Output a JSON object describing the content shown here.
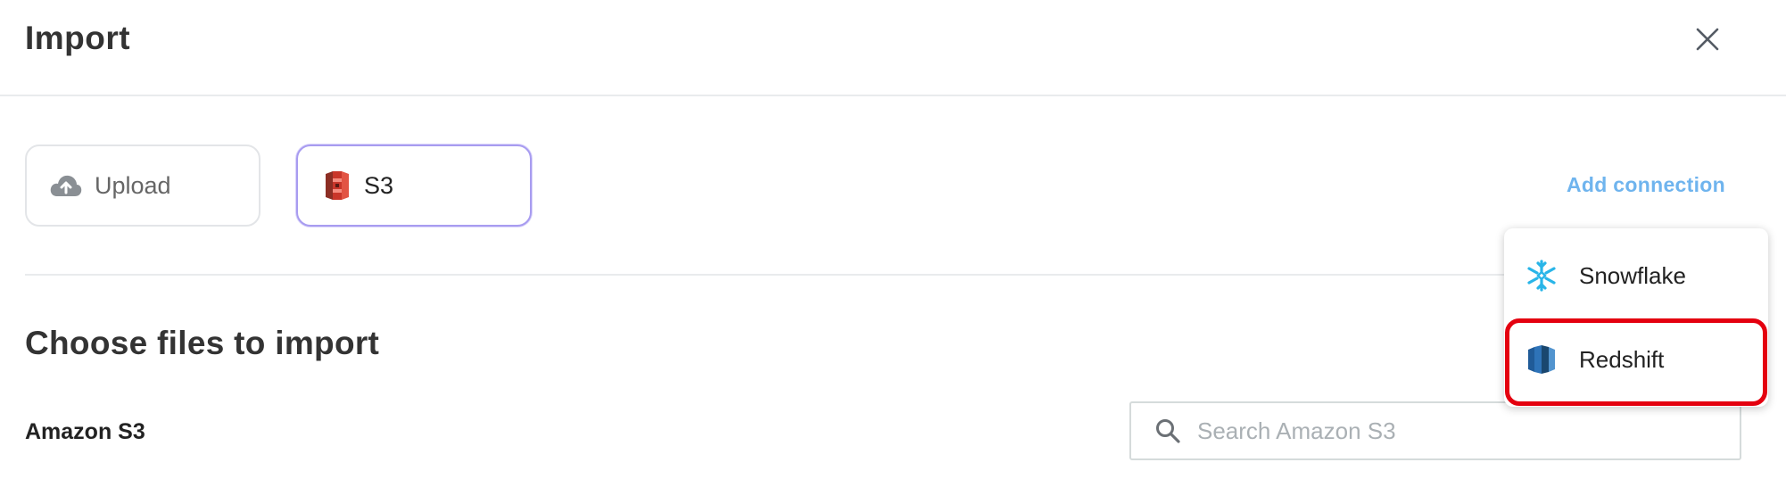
{
  "header": {
    "title": "Import",
    "close_icon": "close-icon"
  },
  "sources": [
    {
      "label": "Upload",
      "icon": "cloud-upload-icon"
    },
    {
      "label": "S3",
      "icon": "s3-bucket-icon",
      "selected": true
    }
  ],
  "add_connection_label": "Add connection",
  "main": {
    "title": "Choose files to import",
    "source_label": "Amazon S3"
  },
  "search": {
    "placeholder": "Search Amazon S3",
    "value": "",
    "icon": "search-icon"
  },
  "connection_menu": {
    "items": [
      {
        "label": "Snowflake",
        "icon": "snowflake-icon"
      },
      {
        "label": "Redshift",
        "icon": "redshift-icon",
        "highlighted": true
      }
    ]
  },
  "colors": {
    "accent_link": "#6fb4ee",
    "selected_border": "#a89cf0",
    "highlight": "#e4000f",
    "snowflake": "#29b5e8",
    "redshift": "#205b98",
    "s3": "#e25444"
  }
}
